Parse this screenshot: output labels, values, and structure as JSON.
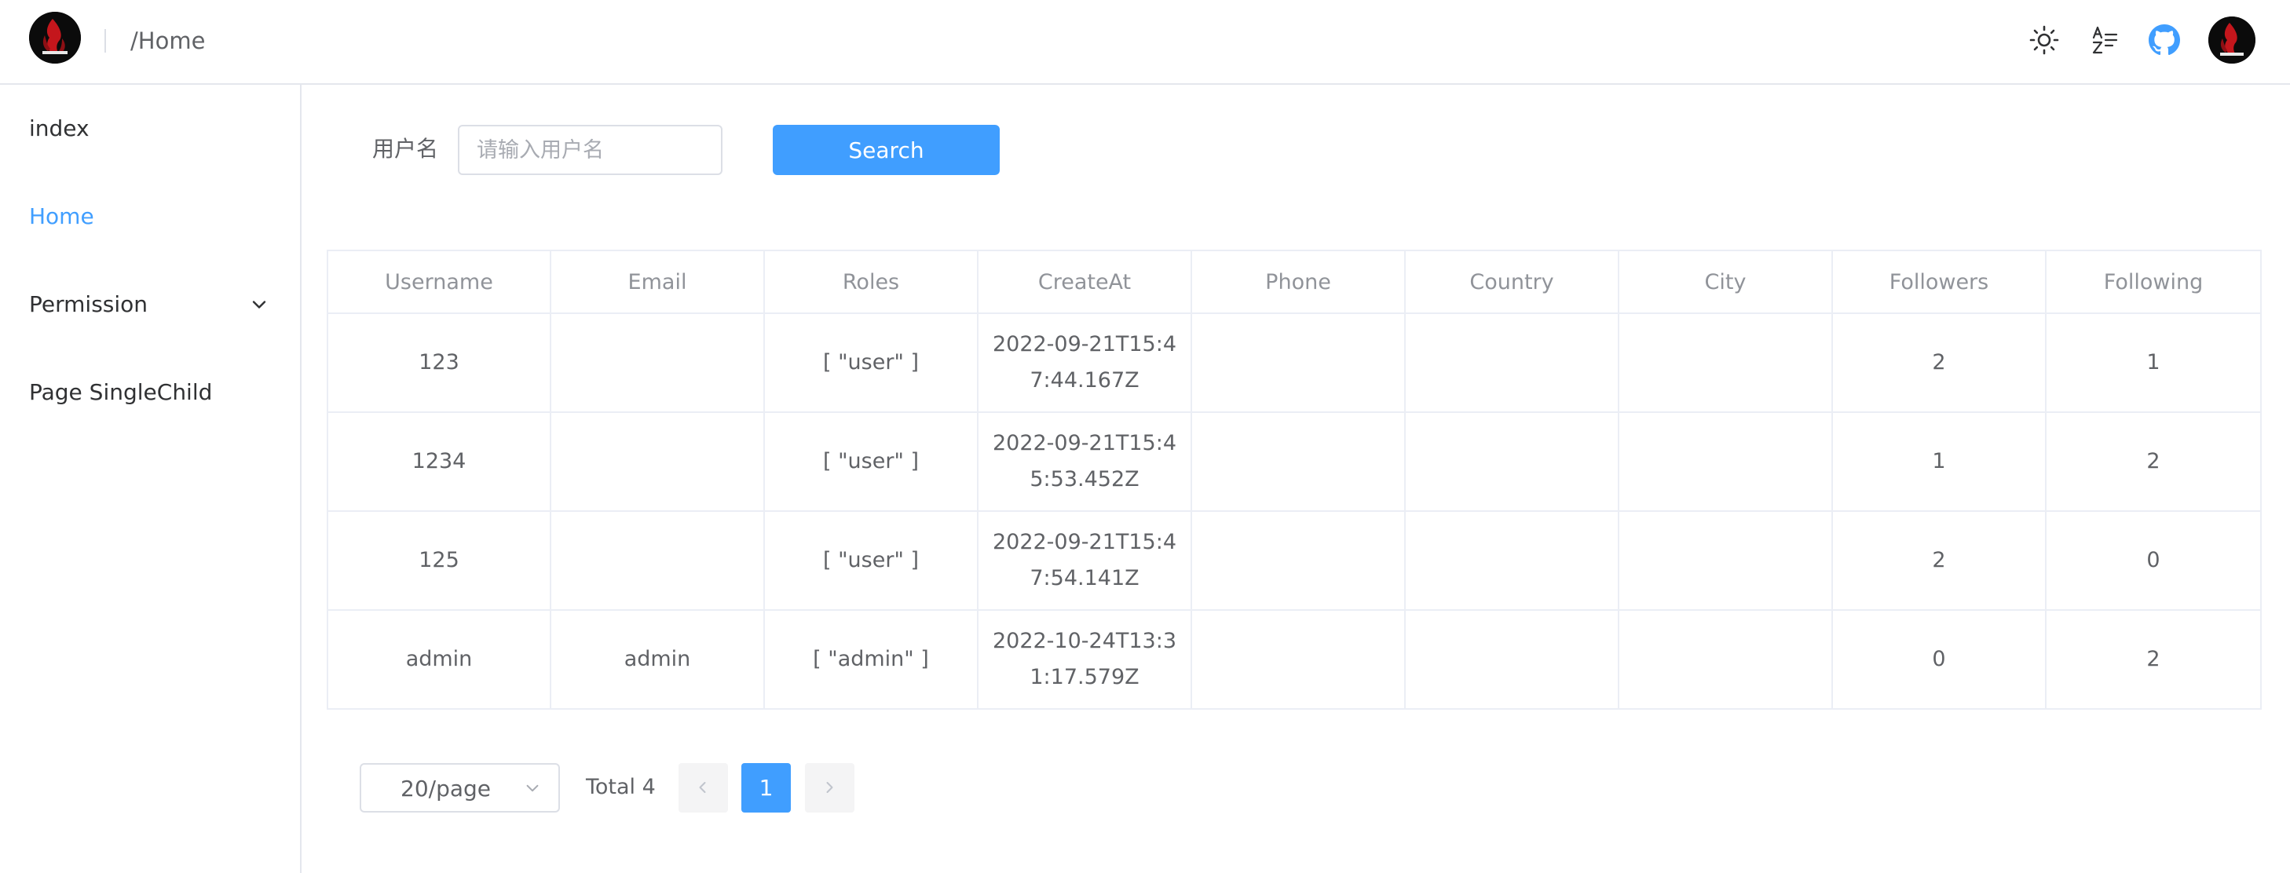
{
  "header": {
    "breadcrumb": "/Home",
    "icons": [
      "sun-icon",
      "translate-icon",
      "github-icon",
      "user-avatar"
    ],
    "colors": {
      "github": "#409eff"
    }
  },
  "sidebar": {
    "items": [
      {
        "label": "index",
        "active": false
      },
      {
        "label": "Home",
        "active": true
      },
      {
        "label": "Permission",
        "active": false,
        "expandable": true
      },
      {
        "label": "Page SingleChild",
        "active": false
      }
    ]
  },
  "search": {
    "label": "用户名",
    "placeholder": "请输入用户名",
    "value": "",
    "button_label": "Search"
  },
  "table": {
    "columns": [
      "Username",
      "Email",
      "Roles",
      "CreateAt",
      "Phone",
      "Country",
      "City",
      "Followers",
      "Following"
    ],
    "rows": [
      [
        "123",
        "",
        "[ \"user\" ]",
        "2022-09-21T15:47:44.167Z",
        "",
        "",
        "",
        "2",
        "1"
      ],
      [
        "1234",
        "",
        "[ \"user\" ]",
        "2022-09-21T15:45:53.452Z",
        "",
        "",
        "",
        "1",
        "2"
      ],
      [
        "125",
        "",
        "[ \"user\" ]",
        "2022-09-21T15:47:54.141Z",
        "",
        "",
        "",
        "2",
        "0"
      ],
      [
        "admin",
        "admin",
        "[ \"admin\" ]",
        "2022-10-24T13:31:17.579Z",
        "",
        "",
        "",
        "0",
        "2"
      ]
    ]
  },
  "pagination": {
    "page_size": "20/page",
    "total": "Total 4",
    "current_page": "1"
  },
  "colors": {
    "accent": "#409eff",
    "border": "#ebeef5",
    "text": "#606266",
    "header_text": "#909399"
  }
}
